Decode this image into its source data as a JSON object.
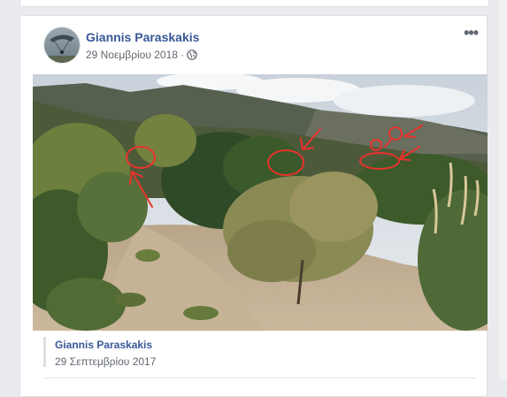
{
  "post": {
    "author": "Giannis Paraskakis",
    "date": "29 Νοεμβρίου 2018",
    "separator": "·",
    "privacy_icon": "globe-icon",
    "menu_icon": "more-options-icon",
    "menu_dots": "•••"
  },
  "photo": {
    "description_icon": "landscape-photo",
    "annotation_color": "#e8322c"
  },
  "shared_post": {
    "author": "Giannis Paraskakis",
    "date": "29 Σεπτεμβρίου 2017"
  },
  "colors": {
    "link": "#385898",
    "meta": "#616770",
    "background": "#e9ebee"
  }
}
